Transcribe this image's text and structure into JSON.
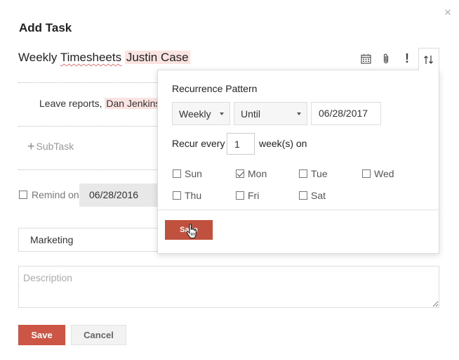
{
  "dialog": {
    "title": "Add Task",
    "close_label": "×"
  },
  "task": {
    "title_word1": "Weekly ",
    "title_word2": "Timesheets",
    "mention": "Justin Case"
  },
  "toolbar": {
    "icons": [
      "calendar-icon",
      "paperclip-icon",
      "priority-icon",
      "recurrence-icon"
    ],
    "priority_glyph": "!",
    "recurrence_glyph": "⇅"
  },
  "subtasks": {
    "item_text": "Leave reports, ",
    "item_mention": "Dan Jenkins",
    "add_label": "SubTask",
    "add_glyph": "+"
  },
  "reminder": {
    "label": "Remind on",
    "date": "06/28/2016",
    "checked": false
  },
  "category": {
    "value": "Marketing"
  },
  "description": {
    "placeholder": "Description"
  },
  "buttons": {
    "save": "Save",
    "cancel": "Cancel"
  },
  "recurrence": {
    "title": "Recurrence Pattern",
    "frequency": "Weekly",
    "end_type": "Until",
    "end_date": "06/28/2017",
    "recur_every_label": "Recur every",
    "interval": "1",
    "interval_unit": "week(s) on",
    "days": [
      {
        "label": "Sun",
        "checked": false
      },
      {
        "label": "Mon",
        "checked": true
      },
      {
        "label": "Tue",
        "checked": false
      },
      {
        "label": "Wed",
        "checked": false
      },
      {
        "label": "Thu",
        "checked": false
      },
      {
        "label": "Fri",
        "checked": false
      },
      {
        "label": "Sat",
        "checked": false
      }
    ],
    "save": "Save"
  },
  "colors": {
    "accent": "#cc5545",
    "mention_bg": "#fbe3e1"
  }
}
